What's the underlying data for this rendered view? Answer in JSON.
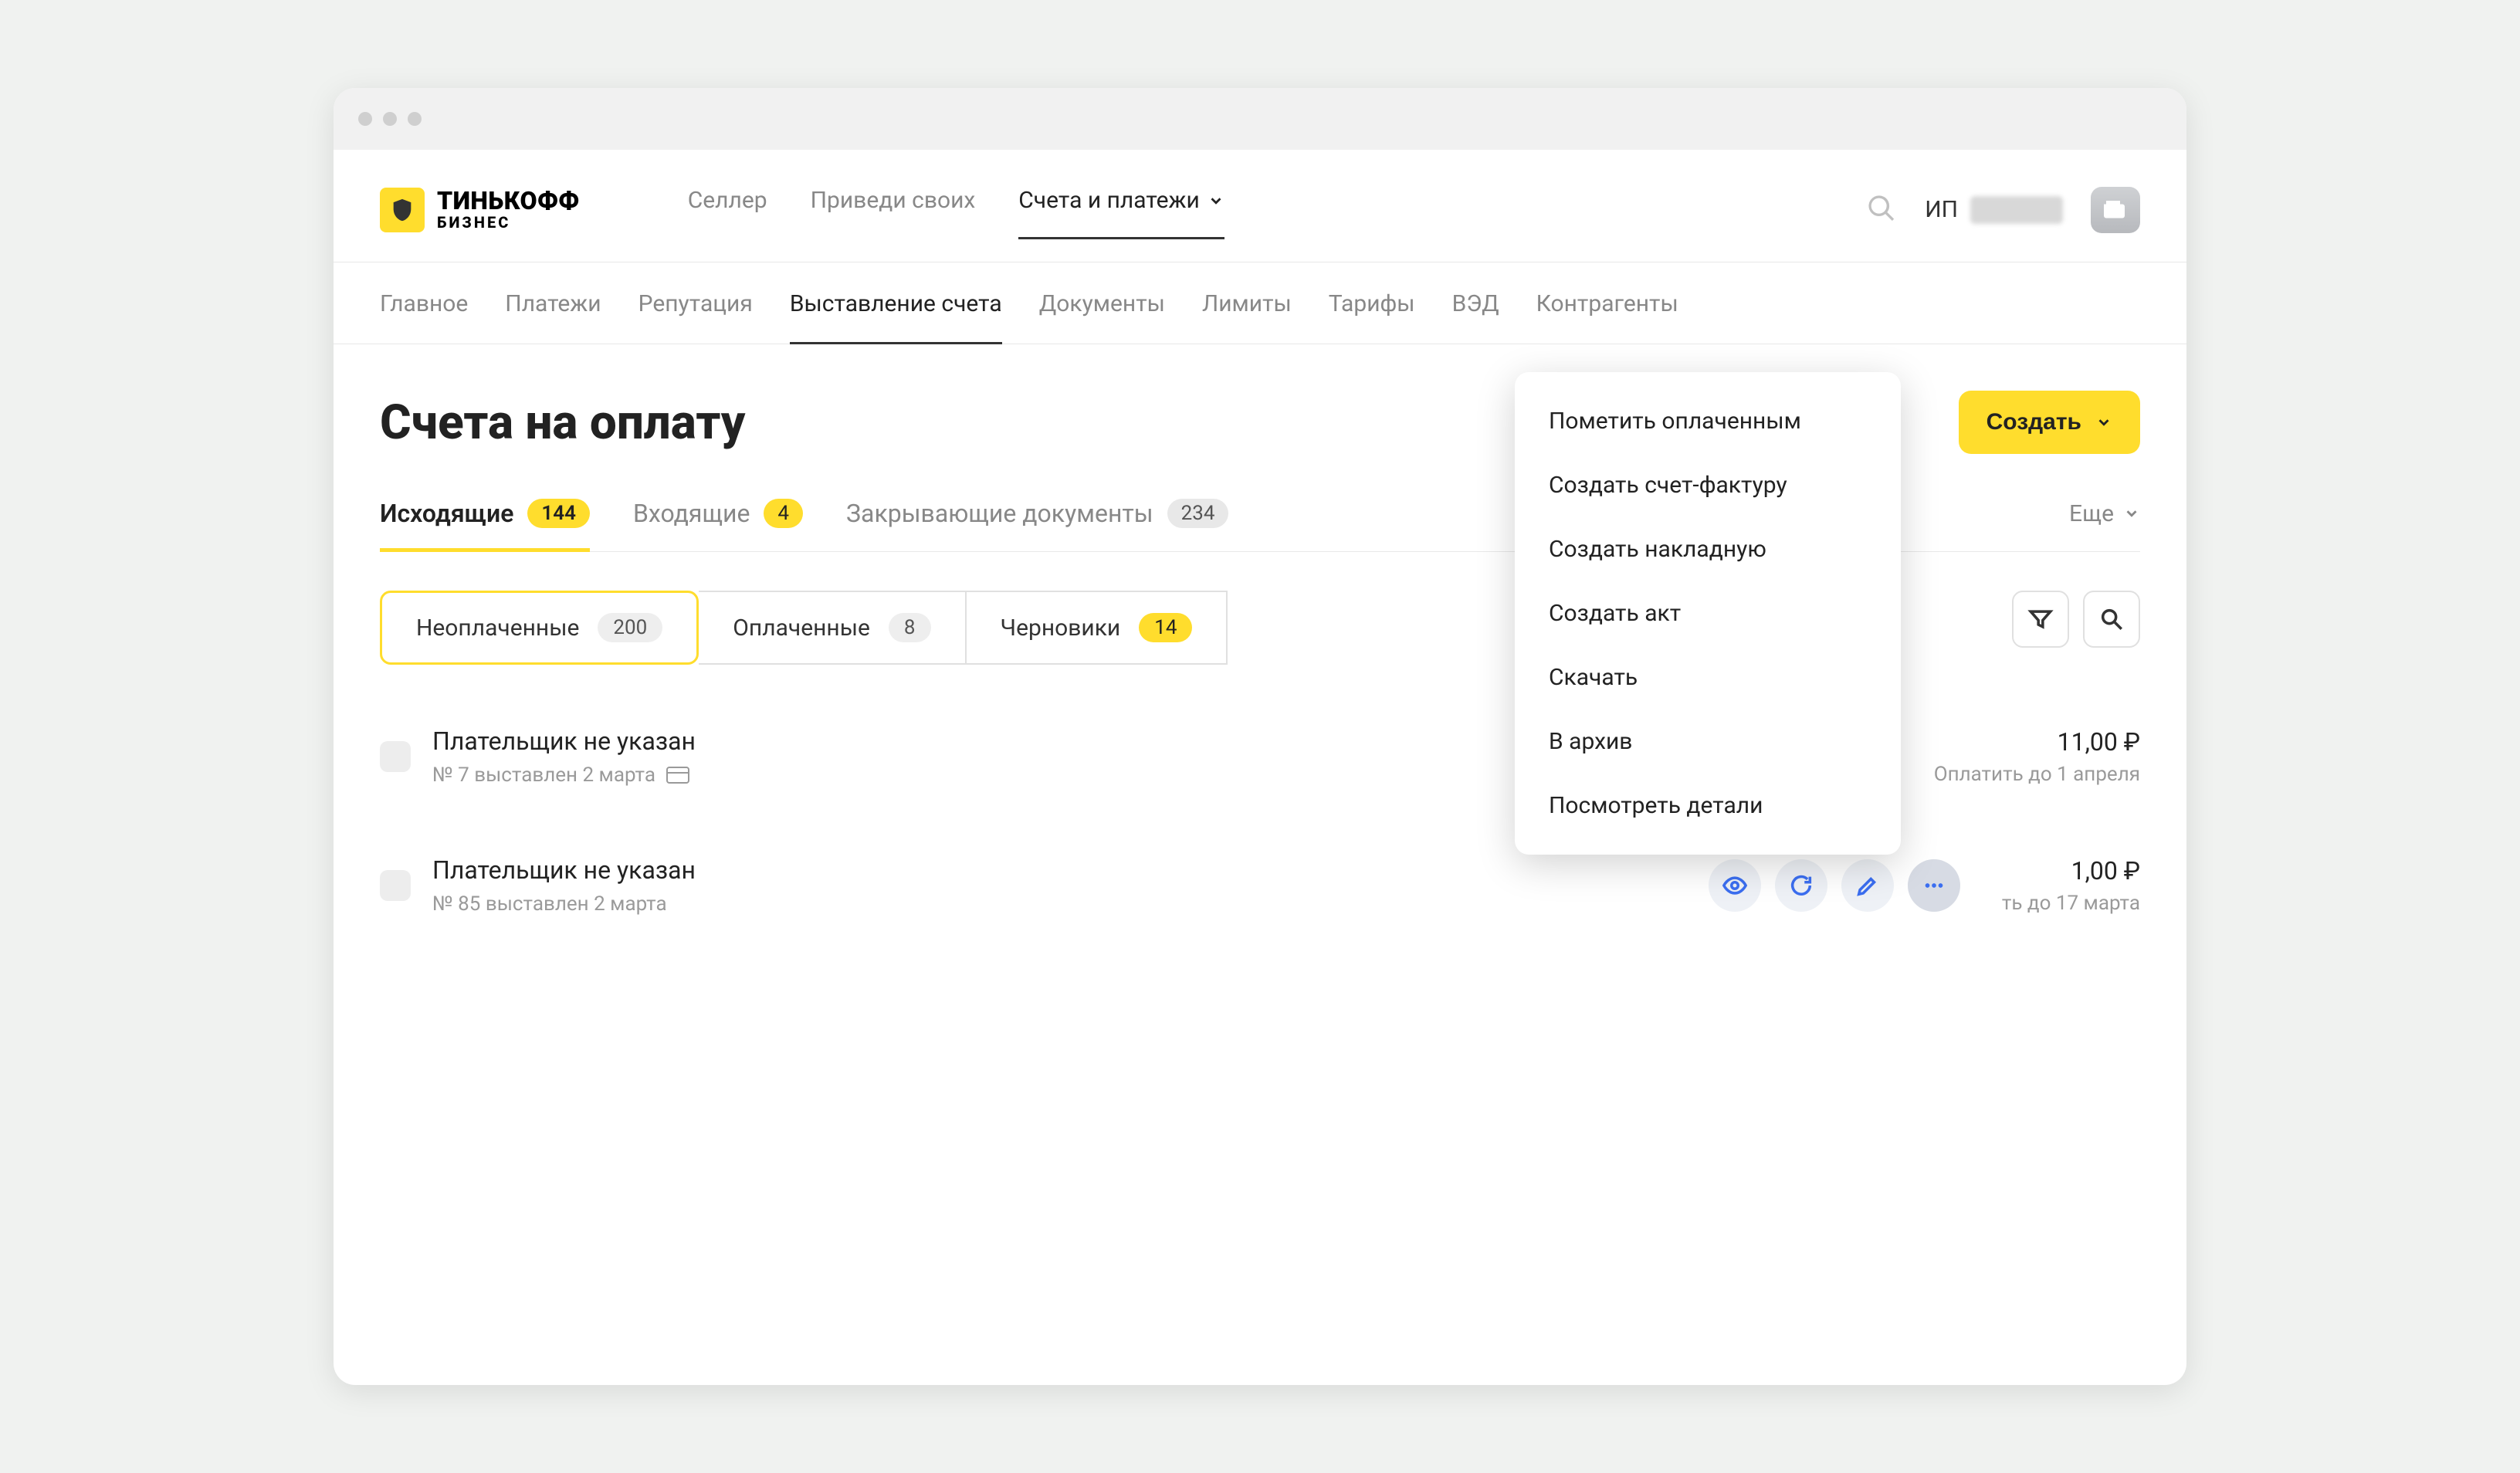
{
  "brand": {
    "name": "ТИНЬКОФФ",
    "sub": "БИЗНЕС"
  },
  "topnav": {
    "items": [
      {
        "label": "Селлер"
      },
      {
        "label": "Приведи своих"
      },
      {
        "label": "Счета и платежи",
        "active": true,
        "dropdown": true
      }
    ]
  },
  "user": {
    "prefix": "ИП"
  },
  "subnav": {
    "items": [
      {
        "label": "Главное"
      },
      {
        "label": "Платежи"
      },
      {
        "label": "Репутация"
      },
      {
        "label": "Выставление счета",
        "active": true
      },
      {
        "label": "Документы"
      },
      {
        "label": "Лимиты"
      },
      {
        "label": "Тарифы"
      },
      {
        "label": "ВЭД"
      },
      {
        "label": "Контрагенты"
      }
    ]
  },
  "page": {
    "title": "Счета на оплату",
    "create_button": "Создать"
  },
  "tabs": {
    "items": [
      {
        "label": "Исходящие",
        "count": "144",
        "active": true,
        "badge_style": "yellow"
      },
      {
        "label": "Входящие",
        "count": "4",
        "badge_style": "yellow"
      },
      {
        "label": "Закрывающие документы",
        "count": "234"
      }
    ],
    "more": "Еще"
  },
  "chips": {
    "items": [
      {
        "label": "Неоплаченные",
        "count": "200",
        "selected": true
      },
      {
        "label": "Оплаченные",
        "count": "8"
      },
      {
        "label": "Черновики",
        "count": "14",
        "badge_style": "yellow"
      }
    ]
  },
  "list": {
    "rows": [
      {
        "title": "Плательщик не указан",
        "subtitle": "№ 7 выставлен 2 марта",
        "has_card_icon": true,
        "amount": "11,00 ₽",
        "due": "Оплатить до 1 апреля"
      },
      {
        "title": "Плательщик не указан",
        "subtitle": "№ 85 выставлен 2 марта",
        "has_card_icon": false,
        "amount": "1,00 ₽",
        "due": "ть до 17 марта",
        "show_actions": true
      }
    ]
  },
  "context_menu": {
    "items": [
      "Пометить оплаченным",
      "Создать счет-фактуру",
      "Создать накладную",
      "Создать акт",
      "Скачать",
      "В архив",
      "Посмотреть детали"
    ]
  }
}
